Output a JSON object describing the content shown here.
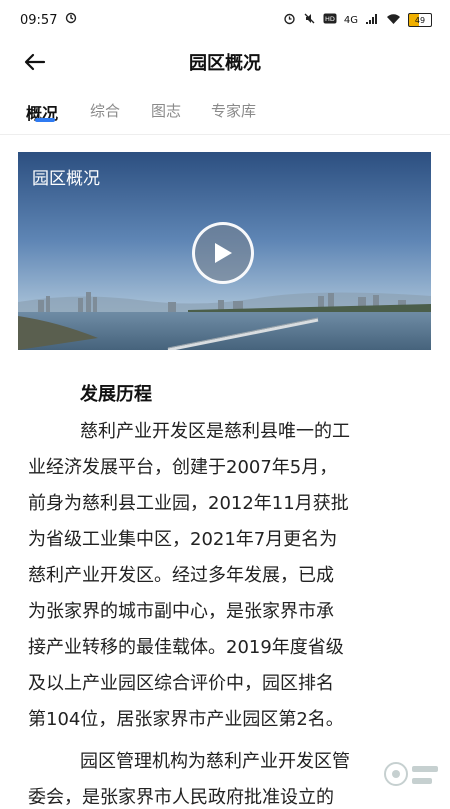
{
  "status_bar": {
    "time": "09:57",
    "network": "4G",
    "battery": "49"
  },
  "header": {
    "title": "园区概况"
  },
  "tabs": [
    {
      "label": "概况",
      "active": true
    },
    {
      "label": "综合",
      "active": false
    },
    {
      "label": "图志",
      "active": false
    },
    {
      "label": "专家库",
      "active": false
    }
  ],
  "video": {
    "caption": "园区概况"
  },
  "article": {
    "heading": "发展历程",
    "lines": [
      "慈利产业开发区是慈利县唯一的工",
      "业经济发展平台，创建于2007年5月，",
      "前身为慈利县工业园，2012年11月获批",
      "为省级工业集中区，2021年7月更名为",
      "慈利产业开发区。经过多年发展，已成",
      "为张家界的城市副中心，是张家界市承",
      "接产业转移的最佳载体。2019年度省级",
      "及以上产业园区综合评价中，园区排名",
      "第104位，居张家界市产业园区第2名。",
      "园区管理机构为慈利产业开发区管",
      "委会，是张家界市人民政府批准设立的"
    ]
  },
  "colors": {
    "accent": "#2f7bf2",
    "tab_inactive": "#8a8a8a",
    "text": "#222222"
  }
}
